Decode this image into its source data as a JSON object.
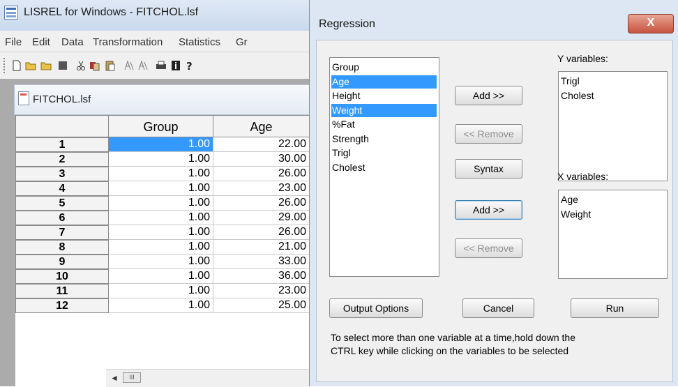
{
  "main_window": {
    "title": "LISREL for Windows - FITCHOL.lsf",
    "menus": [
      "File",
      "Edit",
      "Data",
      "Transformation",
      "Statistics",
      "Gr"
    ],
    "document_title": "FITCHOL.lsf"
  },
  "grid": {
    "columns": [
      "Group",
      "Age"
    ],
    "rows": [
      {
        "num": "1",
        "group": "1.00",
        "age": "22.00"
      },
      {
        "num": "2",
        "group": "1.00",
        "age": "30.00"
      },
      {
        "num": "3",
        "group": "1.00",
        "age": "26.00"
      },
      {
        "num": "4",
        "group": "1.00",
        "age": "23.00"
      },
      {
        "num": "5",
        "group": "1.00",
        "age": "26.00"
      },
      {
        "num": "6",
        "group": "1.00",
        "age": "29.00"
      },
      {
        "num": "7",
        "group": "1.00",
        "age": "26.00"
      },
      {
        "num": "8",
        "group": "1.00",
        "age": "21.00"
      },
      {
        "num": "9",
        "group": "1.00",
        "age": "33.00"
      },
      {
        "num": "10",
        "group": "1.00",
        "age": "36.00"
      },
      {
        "num": "11",
        "group": "1.00",
        "age": "23.00"
      },
      {
        "num": "12",
        "group": "1.00",
        "age": "25.00"
      }
    ],
    "scroll_left": "◄",
    "scroll_thumb": "III"
  },
  "dialog": {
    "title": "Regression",
    "close": "X",
    "variables": [
      "Group",
      "Age",
      "Height",
      "Weight",
      "%Fat",
      "Strength",
      "Trigl",
      "Cholest"
    ],
    "y_label": "Y variables:",
    "y_variables": [
      "Trigl",
      "Cholest"
    ],
    "x_label": "X variables:",
    "x_variables": [
      "Age",
      "Weight"
    ],
    "add_y": "Add >>",
    "remove_y": "<< Remove",
    "syntax": "Syntax",
    "add_x": "Add >>",
    "remove_x": "<< Remove",
    "output_options": "Output Options",
    "cancel": "Cancel",
    "run": "Run",
    "hint_line1": "To select more than one variable at a time,hold down the",
    "hint_line2": "CTRL key while clicking on the variables to be selected"
  },
  "colors": {
    "selection": "#3399ff",
    "dialog_frame": "#dce7f3",
    "close_button": "#c7523e"
  }
}
